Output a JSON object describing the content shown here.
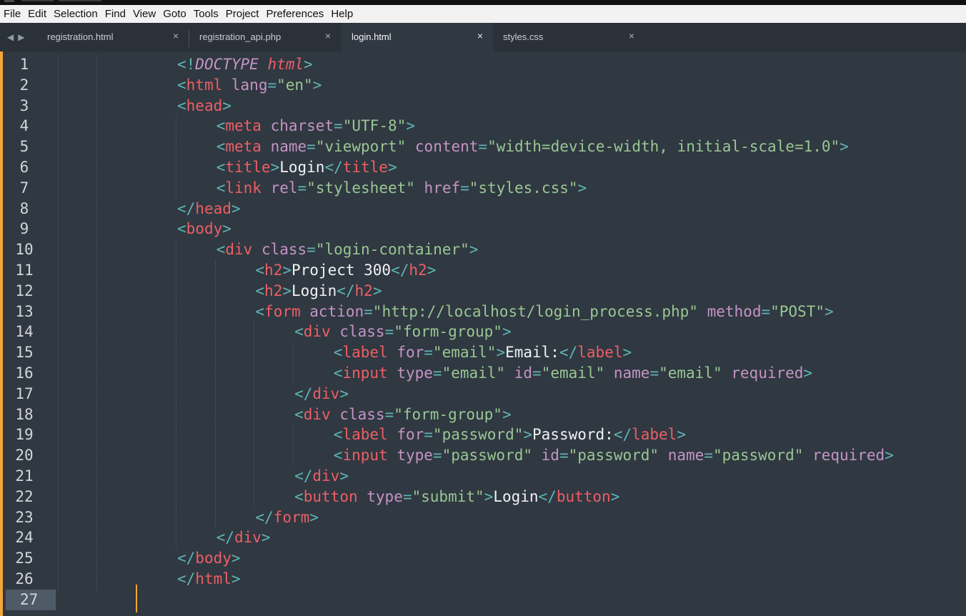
{
  "menu": [
    "File",
    "Edit",
    "Selection",
    "Find",
    "View",
    "Goto",
    "Tools",
    "Project",
    "Preferences",
    "Help"
  ],
  "tabs": [
    {
      "label": "registration.html",
      "close": "×",
      "active": false
    },
    {
      "label": "registration_api.php",
      "close": "×",
      "active": false
    },
    {
      "label": "login.html",
      "close": "×",
      "active": true
    },
    {
      "label": "styles.css",
      "close": "×",
      "active": false
    }
  ],
  "nav": {
    "back": "◀",
    "forward": "▶"
  },
  "colors": {
    "accent": "#f6a637",
    "background": "#303841",
    "tag": "#ec5f66",
    "attribute": "#c594c5",
    "string": "#99c794",
    "punctuation": "#5fb4b4"
  },
  "current_line": 27,
  "lines": [
    {
      "n": "1",
      "indent": 0,
      "tokens": [
        [
          "punct",
          "<!"
        ],
        [
          "doctype",
          "DOCTYPE"
        ],
        [
          "text",
          " "
        ],
        [
          "doctype-tag",
          "html"
        ],
        [
          "punct",
          ">"
        ]
      ]
    },
    {
      "n": "2",
      "indent": 0,
      "tokens": [
        [
          "punct",
          "<"
        ],
        [
          "tag",
          "html"
        ],
        [
          "text",
          " "
        ],
        [
          "attr",
          "lang"
        ],
        [
          "punct",
          "="
        ],
        [
          "str",
          "\"en\""
        ],
        [
          "punct",
          ">"
        ]
      ]
    },
    {
      "n": "3",
      "indent": 0,
      "tokens": [
        [
          "punct",
          "<"
        ],
        [
          "tag",
          "head"
        ],
        [
          "punct",
          ">"
        ]
      ]
    },
    {
      "n": "4",
      "indent": 1,
      "tokens": [
        [
          "punct",
          "<"
        ],
        [
          "tag",
          "meta"
        ],
        [
          "text",
          " "
        ],
        [
          "attr",
          "charset"
        ],
        [
          "punct",
          "="
        ],
        [
          "str",
          "\"UTF-8\""
        ],
        [
          "punct",
          ">"
        ]
      ]
    },
    {
      "n": "5",
      "indent": 1,
      "tokens": [
        [
          "punct",
          "<"
        ],
        [
          "tag",
          "meta"
        ],
        [
          "text",
          " "
        ],
        [
          "attr",
          "name"
        ],
        [
          "punct",
          "="
        ],
        [
          "str",
          "\"viewport\""
        ],
        [
          "text",
          " "
        ],
        [
          "attr",
          "content"
        ],
        [
          "punct",
          "="
        ],
        [
          "str",
          "\"width=device-width, initial-scale=1.0\""
        ],
        [
          "punct",
          ">"
        ]
      ]
    },
    {
      "n": "6",
      "indent": 1,
      "tokens": [
        [
          "punct",
          "<"
        ],
        [
          "tag",
          "title"
        ],
        [
          "punct",
          ">"
        ],
        [
          "text",
          "Login"
        ],
        [
          "punct",
          "</"
        ],
        [
          "tag",
          "title"
        ],
        [
          "punct",
          ">"
        ]
      ]
    },
    {
      "n": "7",
      "indent": 1,
      "tokens": [
        [
          "punct",
          "<"
        ],
        [
          "tag",
          "link"
        ],
        [
          "text",
          " "
        ],
        [
          "attr",
          "rel"
        ],
        [
          "punct",
          "="
        ],
        [
          "str",
          "\"stylesheet\""
        ],
        [
          "text",
          " "
        ],
        [
          "attr",
          "href"
        ],
        [
          "punct",
          "="
        ],
        [
          "str",
          "\"styles.css\""
        ],
        [
          "punct",
          ">"
        ]
      ]
    },
    {
      "n": "8",
      "indent": 0,
      "tokens": [
        [
          "punct",
          "</"
        ],
        [
          "tag",
          "head"
        ],
        [
          "punct",
          ">"
        ]
      ]
    },
    {
      "n": "9",
      "indent": 0,
      "tokens": [
        [
          "punct",
          "<"
        ],
        [
          "tag",
          "body"
        ],
        [
          "punct",
          ">"
        ]
      ]
    },
    {
      "n": "10",
      "indent": 1,
      "tokens": [
        [
          "punct",
          "<"
        ],
        [
          "tag",
          "div"
        ],
        [
          "text",
          " "
        ],
        [
          "attr",
          "class"
        ],
        [
          "punct",
          "="
        ],
        [
          "str",
          "\"login-container\""
        ],
        [
          "punct",
          ">"
        ]
      ]
    },
    {
      "n": "11",
      "indent": 2,
      "tokens": [
        [
          "punct",
          "<"
        ],
        [
          "tag",
          "h2"
        ],
        [
          "punct",
          ">"
        ],
        [
          "text",
          "Project 300"
        ],
        [
          "punct",
          "</"
        ],
        [
          "tag",
          "h2"
        ],
        [
          "punct",
          ">"
        ]
      ]
    },
    {
      "n": "12",
      "indent": 2,
      "tokens": [
        [
          "punct",
          "<"
        ],
        [
          "tag",
          "h2"
        ],
        [
          "punct",
          ">"
        ],
        [
          "text",
          "Login"
        ],
        [
          "punct",
          "</"
        ],
        [
          "tag",
          "h2"
        ],
        [
          "punct",
          ">"
        ]
      ]
    },
    {
      "n": "13",
      "indent": 2,
      "tokens": [
        [
          "punct",
          "<"
        ],
        [
          "tag",
          "form"
        ],
        [
          "text",
          " "
        ],
        [
          "attr",
          "action"
        ],
        [
          "punct",
          "="
        ],
        [
          "str",
          "\"http://localhost/login_process.php\""
        ],
        [
          "text",
          " "
        ],
        [
          "attr",
          "method"
        ],
        [
          "punct",
          "="
        ],
        [
          "str",
          "\"POST\""
        ],
        [
          "punct",
          ">"
        ]
      ]
    },
    {
      "n": "14",
      "indent": 3,
      "tokens": [
        [
          "punct",
          "<"
        ],
        [
          "tag",
          "div"
        ],
        [
          "text",
          " "
        ],
        [
          "attr",
          "class"
        ],
        [
          "punct",
          "="
        ],
        [
          "str",
          "\"form-group\""
        ],
        [
          "punct",
          ">"
        ]
      ]
    },
    {
      "n": "15",
      "indent": 4,
      "tokens": [
        [
          "punct",
          "<"
        ],
        [
          "tag",
          "label"
        ],
        [
          "text",
          " "
        ],
        [
          "attr",
          "for"
        ],
        [
          "punct",
          "="
        ],
        [
          "str",
          "\"email\""
        ],
        [
          "punct",
          ">"
        ],
        [
          "text",
          "Email:"
        ],
        [
          "punct",
          "</"
        ],
        [
          "tag",
          "label"
        ],
        [
          "punct",
          ">"
        ]
      ]
    },
    {
      "n": "16",
      "indent": 4,
      "tokens": [
        [
          "punct",
          "<"
        ],
        [
          "tag",
          "input"
        ],
        [
          "text",
          " "
        ],
        [
          "attr",
          "type"
        ],
        [
          "punct",
          "="
        ],
        [
          "str",
          "\"email\""
        ],
        [
          "text",
          " "
        ],
        [
          "attr",
          "id"
        ],
        [
          "punct",
          "="
        ],
        [
          "str",
          "\"email\""
        ],
        [
          "text",
          " "
        ],
        [
          "attr",
          "name"
        ],
        [
          "punct",
          "="
        ],
        [
          "str",
          "\"email\""
        ],
        [
          "text",
          " "
        ],
        [
          "attr",
          "required"
        ],
        [
          "punct",
          ">"
        ]
      ]
    },
    {
      "n": "17",
      "indent": 3,
      "tokens": [
        [
          "punct",
          "</"
        ],
        [
          "tag",
          "div"
        ],
        [
          "punct",
          ">"
        ]
      ]
    },
    {
      "n": "18",
      "indent": 3,
      "tokens": [
        [
          "punct",
          "<"
        ],
        [
          "tag",
          "div"
        ],
        [
          "text",
          " "
        ],
        [
          "attr",
          "class"
        ],
        [
          "punct",
          "="
        ],
        [
          "str",
          "\"form-group\""
        ],
        [
          "punct",
          ">"
        ]
      ]
    },
    {
      "n": "19",
      "indent": 4,
      "tokens": [
        [
          "punct",
          "<"
        ],
        [
          "tag",
          "label"
        ],
        [
          "text",
          " "
        ],
        [
          "attr",
          "for"
        ],
        [
          "punct",
          "="
        ],
        [
          "str",
          "\"password\""
        ],
        [
          "punct",
          ">"
        ],
        [
          "text",
          "Password:"
        ],
        [
          "punct",
          "</"
        ],
        [
          "tag",
          "label"
        ],
        [
          "punct",
          ">"
        ]
      ]
    },
    {
      "n": "20",
      "indent": 4,
      "tokens": [
        [
          "punct",
          "<"
        ],
        [
          "tag",
          "input"
        ],
        [
          "text",
          " "
        ],
        [
          "attr",
          "type"
        ],
        [
          "punct",
          "="
        ],
        [
          "str",
          "\"password\""
        ],
        [
          "text",
          " "
        ],
        [
          "attr",
          "id"
        ],
        [
          "punct",
          "="
        ],
        [
          "str",
          "\"password\""
        ],
        [
          "text",
          " "
        ],
        [
          "attr",
          "name"
        ],
        [
          "punct",
          "="
        ],
        [
          "str",
          "\"password\""
        ],
        [
          "text",
          " "
        ],
        [
          "attr",
          "required"
        ],
        [
          "punct",
          ">"
        ]
      ]
    },
    {
      "n": "21",
      "indent": 3,
      "tokens": [
        [
          "punct",
          "</"
        ],
        [
          "tag",
          "div"
        ],
        [
          "punct",
          ">"
        ]
      ]
    },
    {
      "n": "22",
      "indent": 3,
      "tokens": [
        [
          "punct",
          "<"
        ],
        [
          "tag",
          "button"
        ],
        [
          "text",
          " "
        ],
        [
          "attr",
          "type"
        ],
        [
          "punct",
          "="
        ],
        [
          "str",
          "\"submit\""
        ],
        [
          "punct",
          ">"
        ],
        [
          "text",
          "Login"
        ],
        [
          "punct",
          "</"
        ],
        [
          "tag",
          "button"
        ],
        [
          "punct",
          ">"
        ]
      ]
    },
    {
      "n": "23",
      "indent": 2,
      "tokens": [
        [
          "punct",
          "</"
        ],
        [
          "tag",
          "form"
        ],
        [
          "punct",
          ">"
        ]
      ]
    },
    {
      "n": "24",
      "indent": 1,
      "tokens": [
        [
          "punct",
          "</"
        ],
        [
          "tag",
          "div"
        ],
        [
          "punct",
          ">"
        ]
      ]
    },
    {
      "n": "25",
      "indent": 0,
      "tokens": [
        [
          "punct",
          "</"
        ],
        [
          "tag",
          "body"
        ],
        [
          "punct",
          ">"
        ]
      ]
    },
    {
      "n": "26",
      "indent": 0,
      "tokens": [
        [
          "punct",
          "</"
        ],
        [
          "tag",
          "html"
        ],
        [
          "punct",
          ">"
        ]
      ]
    },
    {
      "n": "27",
      "indent": 0,
      "tokens": []
    }
  ]
}
